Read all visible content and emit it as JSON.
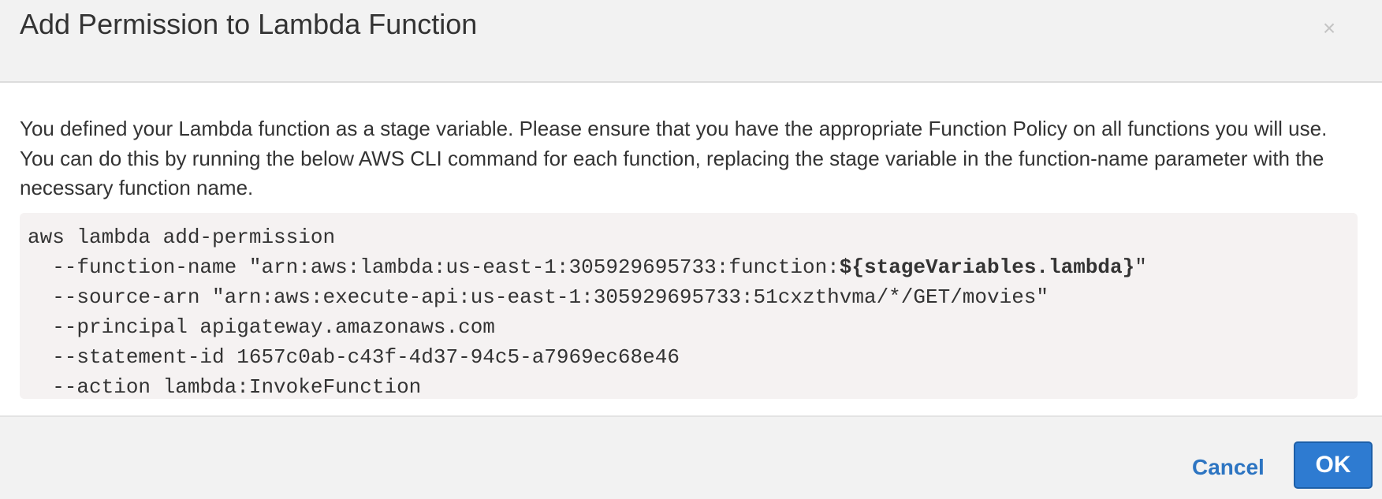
{
  "dialog": {
    "title": "Add Permission to Lambda Function",
    "close_icon": "×"
  },
  "body": {
    "message": "You defined your Lambda function as a stage variable. Please ensure that you have the appropriate Function Policy on all functions you will use. You can do this by running the below AWS CLI command for each function, replacing the stage variable in the function-name parameter with the necessary function name."
  },
  "command": {
    "line1": "aws lambda add-permission",
    "line2_prefix": "  --function-name \"arn:aws:lambda:us-east-1:305929695733:function:",
    "line2_var": "${stageVariables.lambda}",
    "line2_suffix": "\"",
    "line3": "  --source-arn \"arn:aws:execute-api:us-east-1:305929695733:51cxzthvma/*/GET/movies\"",
    "line4": "  --principal apigateway.amazonaws.com",
    "line5": "  --statement-id 1657c0ab-c43f-4d37-94c5-a7969ec68e46",
    "line6": "  --action lambda:InvokeFunction"
  },
  "footer": {
    "cancel_label": "Cancel",
    "ok_label": "OK"
  },
  "colors": {
    "header_bg": "#f2f2f2",
    "code_bg": "#f5f2f2",
    "link": "#2d75c2",
    "primary_button": "#2e7bd1"
  }
}
